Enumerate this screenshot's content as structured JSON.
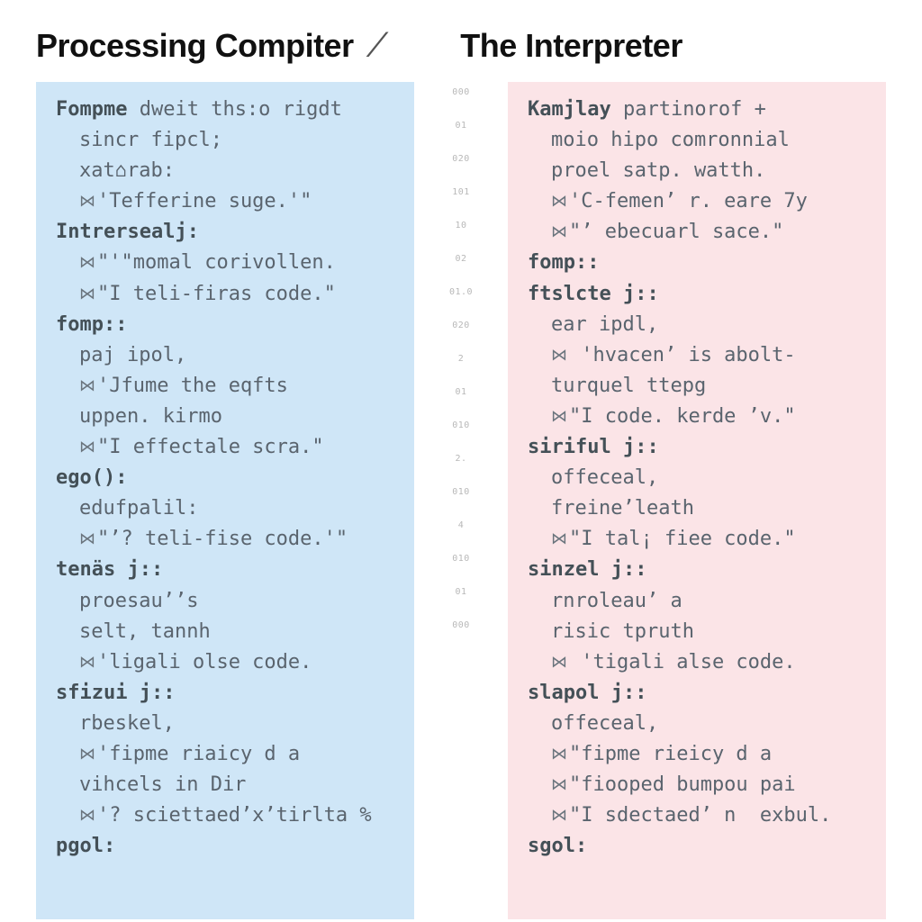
{
  "header": {
    "left_title": "Processing Compiter",
    "right_title": "The Interpreter"
  },
  "gutter_marks": [
    "000",
    "01",
    "020",
    "101",
    "10",
    "02",
    "01.0",
    "020",
    "2",
    "01",
    "010",
    "2.",
    "010",
    "4",
    "010",
    "01",
    "000"
  ],
  "left_panel": {
    "lines": [
      {
        "kw": "Fompme",
        "rest": " dweit ths:o rigdt"
      },
      {
        "indent": true,
        "rest": "sincr fipcl;"
      },
      {
        "indent": true,
        "rest": "xat⌂rab:"
      },
      {
        "indent": true,
        "glyph": true,
        "rest": "'Tefferine suge.'\""
      },
      {
        "kw": "Intrersealj:",
        "rest": ""
      },
      {
        "indent": true,
        "glyph": true,
        "rest": "\"'\"momal corivollen."
      },
      {
        "indent": true,
        "glyph": true,
        "rest": "\"I teli-firas code.\""
      },
      {
        "kw": "fomp::",
        "rest": ""
      },
      {
        "indent": true,
        "rest": "paj ipol,"
      },
      {
        "indent": true,
        "glyph": true,
        "rest": "'Jfume the eqfts"
      },
      {
        "indent": true,
        "rest": "uppen. kirmo"
      },
      {
        "indent": true,
        "glyph": true,
        "rest": "\"I effectale scra.\""
      },
      {
        "kw": "ego():",
        "rest": ""
      },
      {
        "indent": true,
        "rest": "edufpalil:"
      },
      {
        "indent": true,
        "glyph": true,
        "rest": "\"’? teli-fise code.'\""
      },
      {
        "kw": "tenäs j::",
        "rest": ""
      },
      {
        "indent": true,
        "rest": "proesau’’s"
      },
      {
        "indent": true,
        "rest": "selt, tannh"
      },
      {
        "indent": true,
        "glyph": true,
        "rest": "'ligali olse code."
      },
      {
        "kw": "sfizui j::",
        "rest": ""
      },
      {
        "indent": true,
        "rest": "rbeskel,"
      },
      {
        "indent": true,
        "glyph": true,
        "rest": "'fipme riaicy d a"
      },
      {
        "indent": true,
        "rest": "vihcels in Dir"
      },
      {
        "indent": true,
        "glyph": true,
        "rest": "'? sciettaed’x’tirlta %"
      },
      {
        "kw": "pgol:",
        "rest": ""
      }
    ]
  },
  "right_panel": {
    "lines": [
      {
        "kw": "Kamjlay",
        "rest": " partinorof +"
      },
      {
        "indent": true,
        "rest": "moio hipo comronnial"
      },
      {
        "indent": true,
        "rest": "proel satp. watth."
      },
      {
        "indent": true,
        "glyph": true,
        "rest": "'C-femen’ r. eare 7y"
      },
      {
        "indent": true,
        "glyph": true,
        "rest": "\"’ ebecuarl sace.\""
      },
      {
        "kw": "fomp::",
        "rest": ""
      },
      {
        "kw": "ftslcte j::",
        "rest": ""
      },
      {
        "indent": true,
        "rest": "ear ipdl,"
      },
      {
        "indent": true,
        "glyph": true,
        "rest": " 'hvacen’ is abolt-"
      },
      {
        "indent": true,
        "rest": "turquel ttepg"
      },
      {
        "indent": true,
        "glyph": true,
        "rest": "\"I code. kerde ’v.\""
      },
      {
        "kw": "siriful j::",
        "rest": ""
      },
      {
        "indent": true,
        "rest": "offeceal,"
      },
      {
        "indent": true,
        "rest": "freine’leath"
      },
      {
        "indent": true,
        "glyph": true,
        "rest": "\"I tal¡ fiee code.\""
      },
      {
        "kw": "sinzel j::",
        "rest": ""
      },
      {
        "indent": true,
        "rest": "rnroleau’ a"
      },
      {
        "indent": true,
        "rest": "risic tpruth"
      },
      {
        "indent": true,
        "glyph": true,
        "rest": " 'tigali alse code."
      },
      {
        "kw": "slapol j::",
        "rest": ""
      },
      {
        "indent": true,
        "rest": "offeceal,"
      },
      {
        "indent": true,
        "glyph": true,
        "rest": "\"fipme rieicy d a"
      },
      {
        "indent": true,
        "glyph": true,
        "rest": "\"fiooped bumpou pai"
      },
      {
        "indent": true,
        "glyph": true,
        "rest": "\"I sdectaed’ n  exbul."
      },
      {
        "kw": "sgol:",
        "rest": ""
      }
    ]
  }
}
